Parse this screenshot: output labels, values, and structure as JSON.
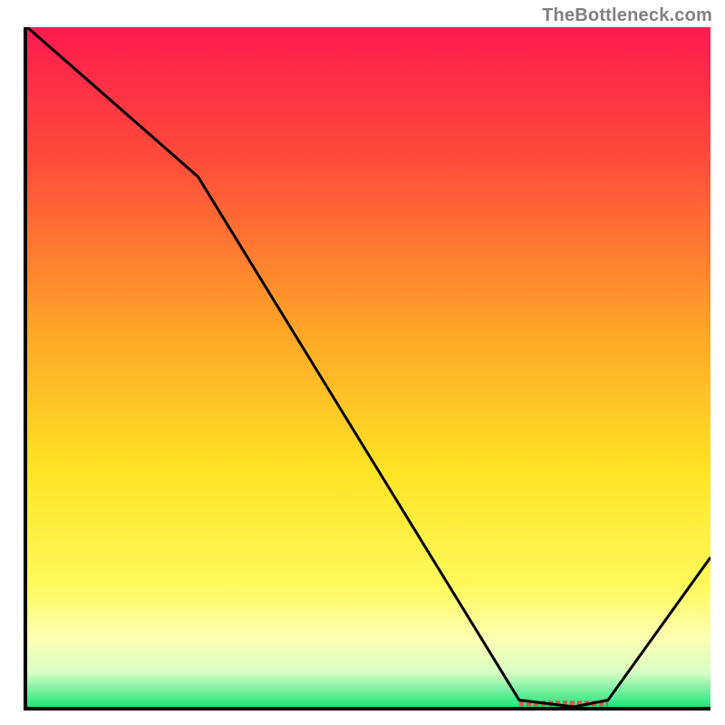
{
  "attribution": "TheBottleneck.com",
  "chart_data": {
    "type": "line",
    "title": "",
    "xlabel": "",
    "ylabel": "",
    "xlim": [
      0,
      100
    ],
    "ylim": [
      0,
      100
    ],
    "x": [
      0,
      25,
      72,
      80,
      85,
      100
    ],
    "values": [
      100,
      78,
      1,
      0,
      1,
      22
    ],
    "series_color": "#000000",
    "axis_color": "#000000",
    "background_gradient": {
      "stops": [
        {
          "offset": 0.0,
          "color": "#ff1a4f"
        },
        {
          "offset": 0.2,
          "color": "#ff4d3a"
        },
        {
          "offset": 0.45,
          "color": "#ffa628"
        },
        {
          "offset": 0.65,
          "color": "#ffe324"
        },
        {
          "offset": 0.82,
          "color": "#fff95b"
        },
        {
          "offset": 0.9,
          "color": "#fdffb3"
        },
        {
          "offset": 0.95,
          "color": "#d7ffc3"
        },
        {
          "offset": 0.97,
          "color": "#8cf2a9"
        },
        {
          "offset": 1.0,
          "color": "#1fe67a"
        }
      ]
    },
    "marker_band": {
      "x_start": 72,
      "x_end": 85,
      "y": 0.5,
      "color": "#e2524b"
    }
  }
}
